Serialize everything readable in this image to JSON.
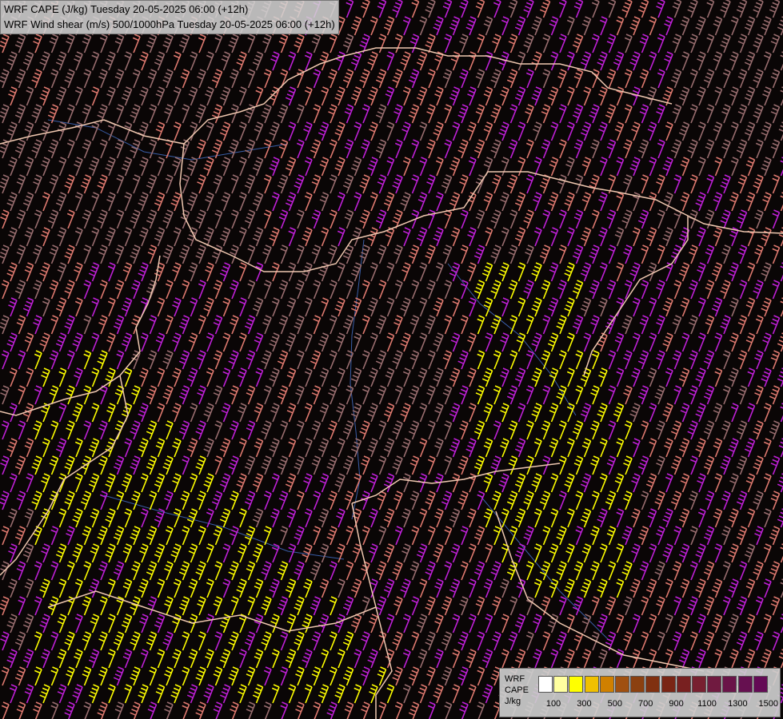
{
  "title": {
    "line1": "WRF CAPE (J/kg) Tuesday 20-05-2025 06:00 (+12h)",
    "line2": "WRF Wind shear (m/s) 500/1000hPa Tuesday 20-05-2025 06:00 (+12h)"
  },
  "legend": {
    "name_lines": [
      "WRF",
      "CAPE",
      "J/kg"
    ],
    "swatches": [
      "#ffffff",
      "#ffffa0",
      "#ffff00",
      "#f0c000",
      "#d08000",
      "#a05010",
      "#8b4010",
      "#803010",
      "#7a2515",
      "#782020",
      "#782030",
      "#701a40",
      "#6a1448",
      "#661050",
      "#640a55"
    ],
    "ticks": [
      "100",
      "300",
      "500",
      "700",
      "900",
      "1100",
      "1300",
      "1500"
    ]
  },
  "colors": {
    "background": "#000000",
    "barb_low": "#9a6e70",
    "barb_mid": "#e07a70",
    "barb_high": "#c020d8",
    "barb_cape": "#ffff00",
    "border": "#f0c8b0",
    "river": "#3a5ea8"
  }
}
